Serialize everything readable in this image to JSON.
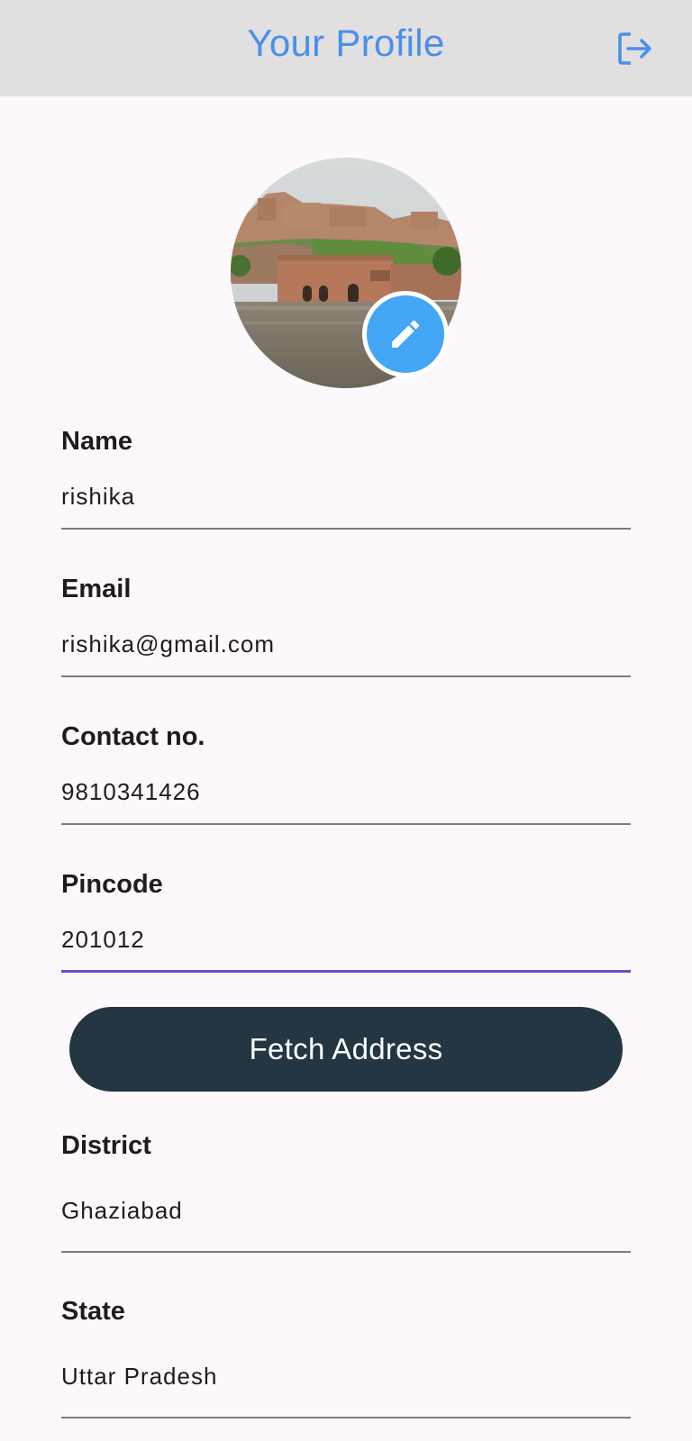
{
  "header": {
    "title": "Your Profile",
    "logout_icon": "logout-icon",
    "background": "#e2dfe1",
    "title_color": "#4a8fe8"
  },
  "avatar": {
    "description_icon": "profile-photo",
    "edit_icon": "pencil-icon",
    "edit_color": "#42a5f5"
  },
  "fields": [
    {
      "label": "Name",
      "value": "rishika"
    },
    {
      "label": "Email",
      "value": "rishika@gmail.com"
    },
    {
      "label": "Contact no.",
      "value": "9810341426"
    },
    {
      "label": "Pincode",
      "value": "201012",
      "focused": true
    },
    {
      "label": "District",
      "value": "Ghaziabad"
    },
    {
      "label": "State",
      "value": "Uttar Pradesh"
    }
  ],
  "fetch_button": {
    "label": "Fetch Address",
    "color": "#233641"
  },
  "accent_color": "#6b4fbb"
}
